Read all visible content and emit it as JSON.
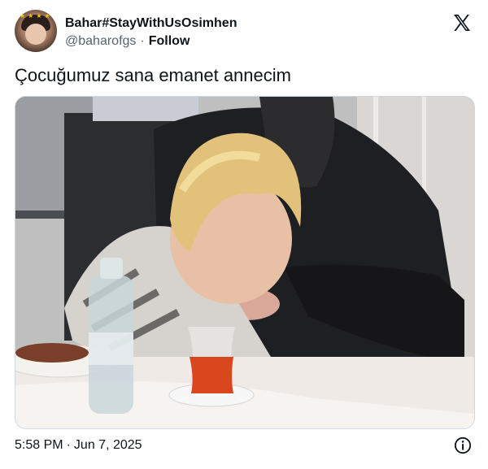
{
  "user": {
    "display_name": "Bahar#StayWithUsOsimhen",
    "handle": "@baharofgs",
    "separator": "·",
    "follow_label": "Follow"
  },
  "tweet": {
    "text": "Çocuğumuz sana emanet annecim"
  },
  "footer": {
    "time": "5:58 PM",
    "separator": "·",
    "date": "Jun 7, 2025"
  },
  "icons": {
    "brand": "x-logo-icon",
    "info": "info-icon"
  },
  "colors": {
    "text_primary": "#0f1419",
    "text_secondary": "#536471",
    "border": "#cfd9de"
  }
}
